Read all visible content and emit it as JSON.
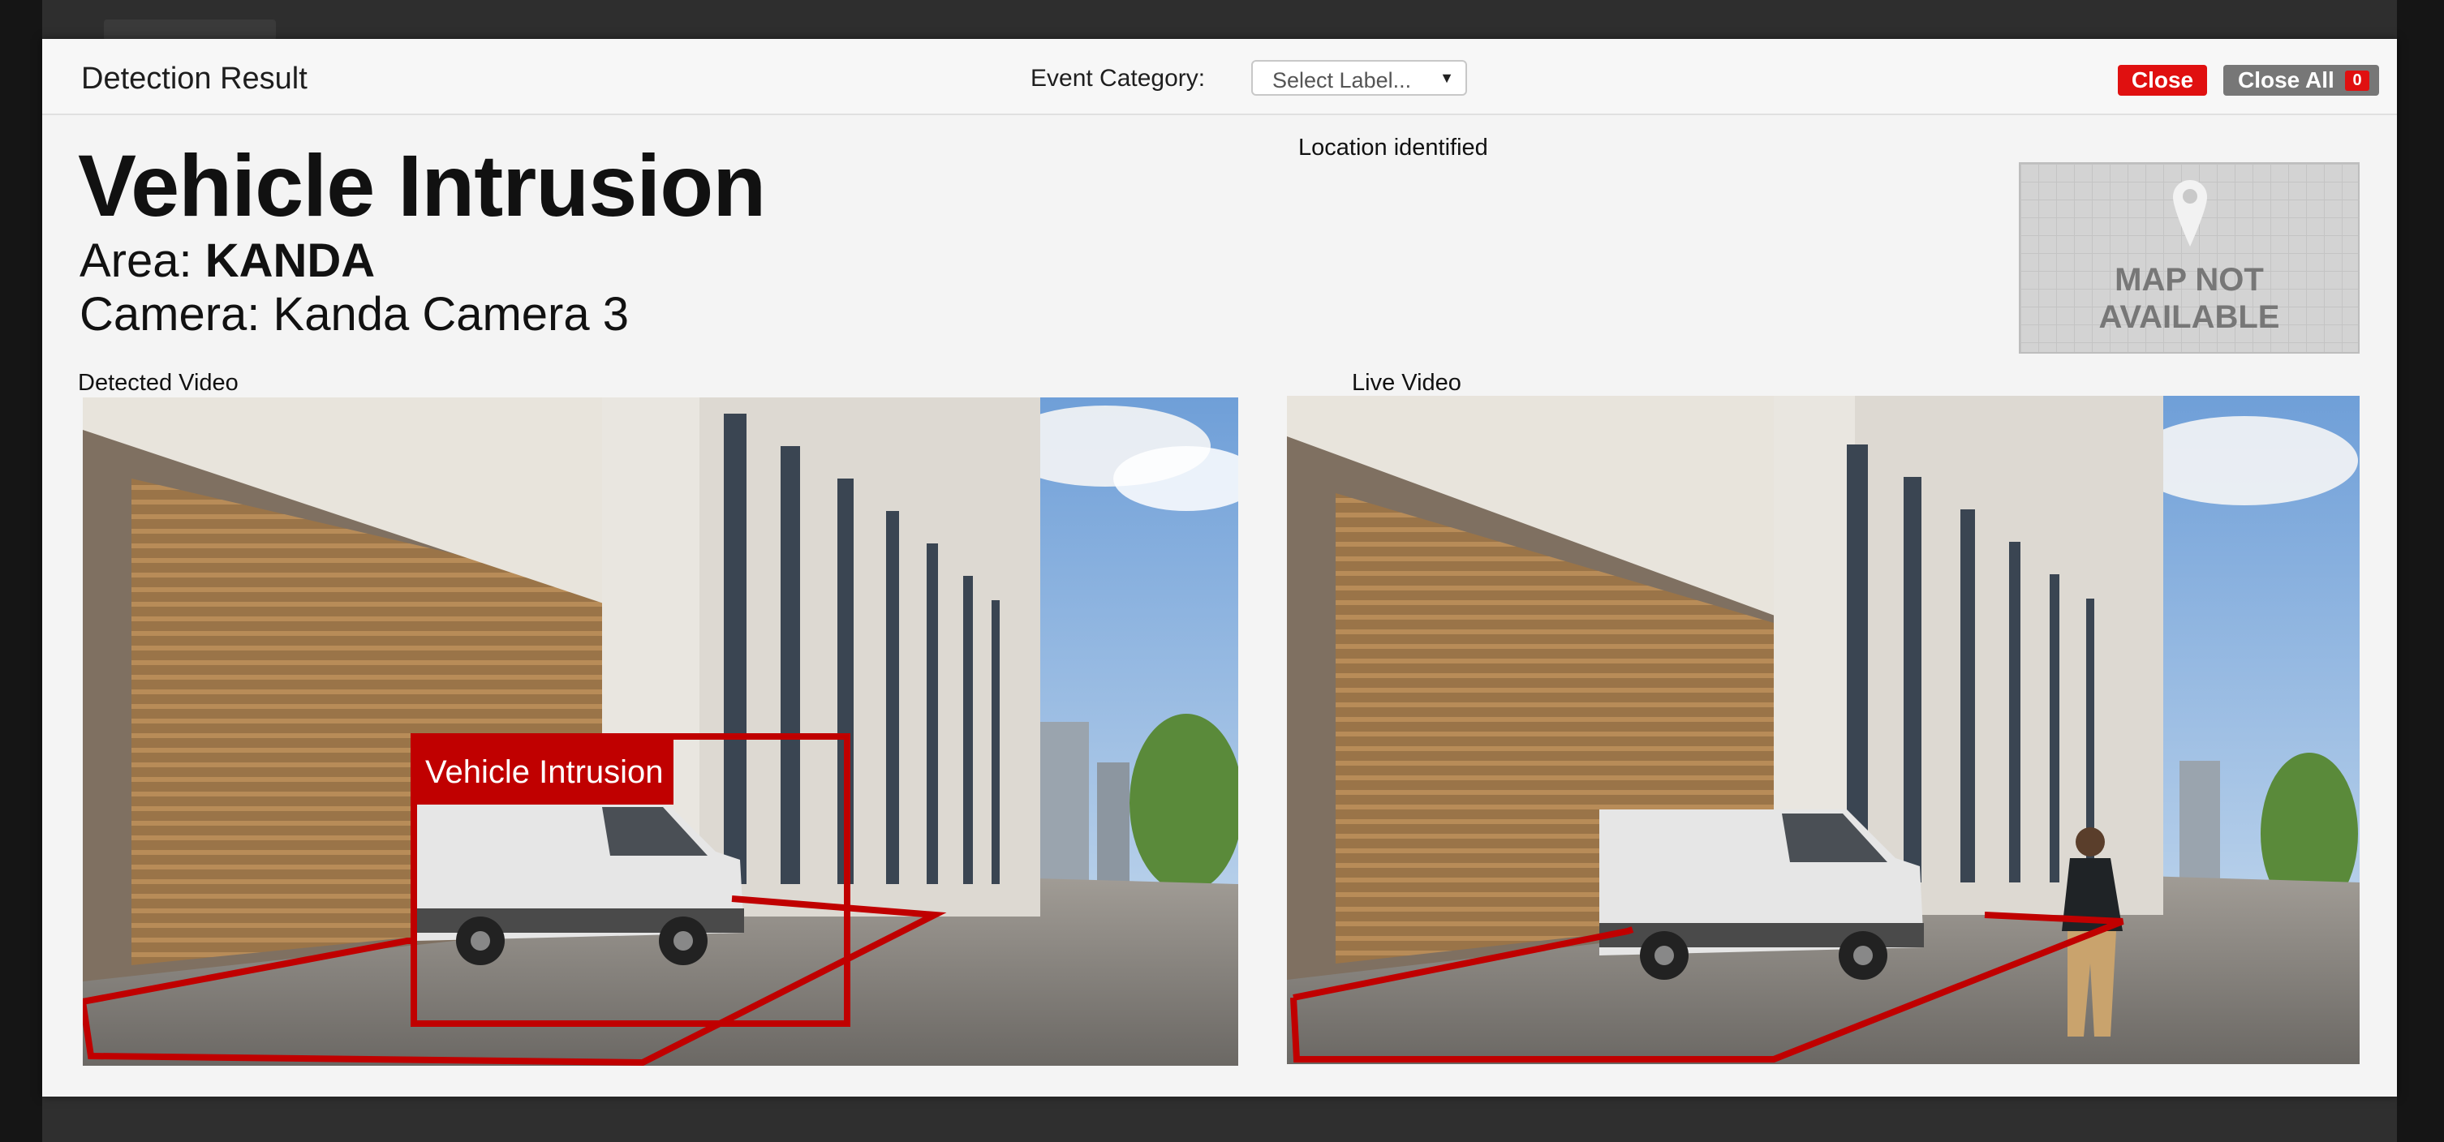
{
  "header": {
    "title": "Detection Result",
    "event_category_label": "Event Category:",
    "select_placeholder": "Select Label...",
    "close_label": "Close",
    "close_all_label": "Close All",
    "close_all_count": "0"
  },
  "event": {
    "title": "Vehicle Intrusion",
    "area_prefix": "Area:",
    "area_value": "KANDA",
    "camera_line": "Camera: Kanda Camera 3"
  },
  "location": {
    "status": "Location identified",
    "map_line1": "MAP NOT",
    "map_line2": "AVAILABLE"
  },
  "videos": {
    "detected_label": "Detected Video",
    "live_label": "Live Video",
    "detection_tag": "Vehicle Intrusion"
  },
  "colors": {
    "close_button": "#e01010",
    "close_all_button": "#777777",
    "detection_red": "#c00000"
  }
}
